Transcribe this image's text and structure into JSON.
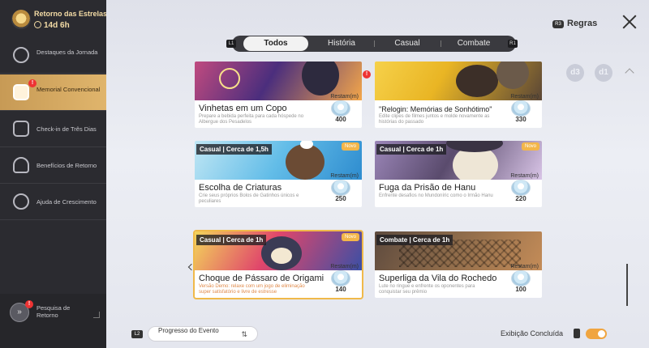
{
  "sidebar": {
    "title": "Retorno das Estrelas",
    "timer": "14d 6h",
    "items": [
      {
        "label": "Destaques da Jornada"
      },
      {
        "label": "Memorial Convencional"
      },
      {
        "label": "Check-in de Três Dias"
      },
      {
        "label": "Benefícios de Retorno"
      },
      {
        "label": "Ajuda de Crescimento"
      }
    ],
    "bottom": {
      "label": "Pesquisa de Retorno"
    },
    "alert": "!"
  },
  "header": {
    "rules_key": "R3",
    "rules": "Regras"
  },
  "tabs": {
    "left_key": "L1",
    "right_key": "R1",
    "items": [
      {
        "label": "Todos"
      },
      {
        "label": "História"
      },
      {
        "label": "Casual"
      },
      {
        "label": "Combate"
      }
    ]
  },
  "reward_label": "Restam",
  "new_label": "Novo",
  "cards": [
    {
      "title": "Vinhetas em um Copo",
      "desc": "Prepare a bebida perfeita para cada hóspede no Albergue dos Pesadelos",
      "reward": "400"
    },
    {
      "title": "\"Relogin: Memórias de Sonhótimo\"",
      "desc": "Edite clipes de filmes juntos e molde novamente as histórias do passado",
      "reward": "330"
    },
    {
      "tag": "Casual | Cerca de 1,5h",
      "title": "Escolha de Criaturas",
      "desc": "Crie seus próprios Bolos de Gatinhos únicos e peculiares",
      "reward": "250"
    },
    {
      "tag": "Casual | Cerca de 1h",
      "title": "Fuga da Prisão de Hanu",
      "desc": "Enfrente desafios no Mundoníric como o Irmão Hanu",
      "reward": "220"
    },
    {
      "tag": "Casual | Cerca de 1h",
      "title": "Choque de Pássaro de Origami",
      "desc": "Versão Demo: relaxe com um jogo de eliminação super satisfatório e livre de estresse",
      "reward": "140"
    },
    {
      "tag": "Combate | Cerca de 1h",
      "title": "Superliga da Vila do Rochedo",
      "desc": "Lute no ringue e enfrente os oponentes para conquistar seu prêmio",
      "reward": "100"
    }
  ],
  "floats": {
    "a": "d3",
    "b": "d1"
  },
  "footer": {
    "key": "L2",
    "progress": "Progresso do Evento",
    "sort_icon": "⇅",
    "done": "Exibição Concluída"
  },
  "colors": {
    "accent": "#e0b56c",
    "toggle": "#f0a540",
    "alert": "#e33333"
  }
}
